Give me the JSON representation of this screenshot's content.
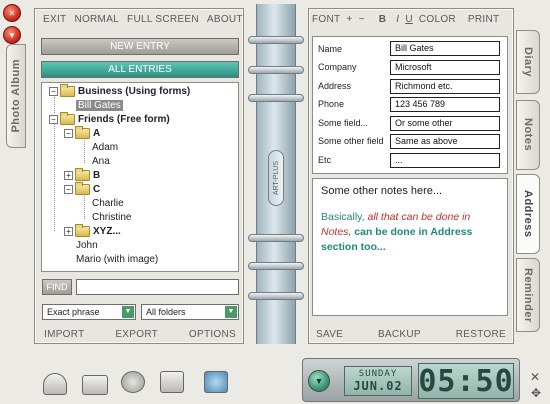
{
  "left_tabs": {
    "photo_album": "Photo Album"
  },
  "right_tabs": [
    "Diary",
    "Notes",
    "Address",
    "Reminder"
  ],
  "left_page": {
    "toolbar": [
      "EXIT",
      "NORMAL",
      "FULL SCREEN",
      "ABOUT"
    ],
    "new_entry": "NEW ENTRY",
    "all_entries": "ALL ENTRIES",
    "tree": {
      "business": "Business (Using forms)",
      "bill_gates": "Bill Gates",
      "friends": "Friends (Free form)",
      "a": "A",
      "adam": "Adam",
      "ana": "Ana",
      "b": "B",
      "c": "C",
      "charlie": "Charlie",
      "christine": "Christine",
      "xyz": "XYZ...",
      "john": "John",
      "mario": "Mario (with image)"
    },
    "find_label": "FIND",
    "find_value": "",
    "match_select": "Exact phrase",
    "folder_select": "All folders",
    "footer": [
      "IMPORT",
      "EXPORT",
      "OPTIONS"
    ]
  },
  "spine_label": "ART-PLUS",
  "right_page": {
    "toolbar": [
      "FONT",
      "+",
      "−",
      "B",
      "I",
      "U",
      "COLOR",
      "PRINT"
    ],
    "fields": [
      {
        "label": "Name",
        "value": "Bill Gates"
      },
      {
        "label": "Company",
        "value": "Microsoft"
      },
      {
        "label": "Address",
        "value": "Richmond etc."
      },
      {
        "label": "Phone",
        "value": "123 456 789"
      },
      {
        "label": "Some field...",
        "value": "Or some other"
      },
      {
        "label": "Some other field",
        "value": "Same as above"
      },
      {
        "label": "Etc",
        "value": "..."
      }
    ],
    "notes": {
      "line1": "Some other notes here...",
      "basically": "Basically,",
      "red": "all that can be done in Notes,",
      "teal": "can be done in Address section too..."
    },
    "footer": [
      "SAVE",
      "BACKUP",
      "RESTORE"
    ]
  },
  "clock": {
    "day": "SUNDAY",
    "date": "JUN.02",
    "time": "05:50"
  }
}
